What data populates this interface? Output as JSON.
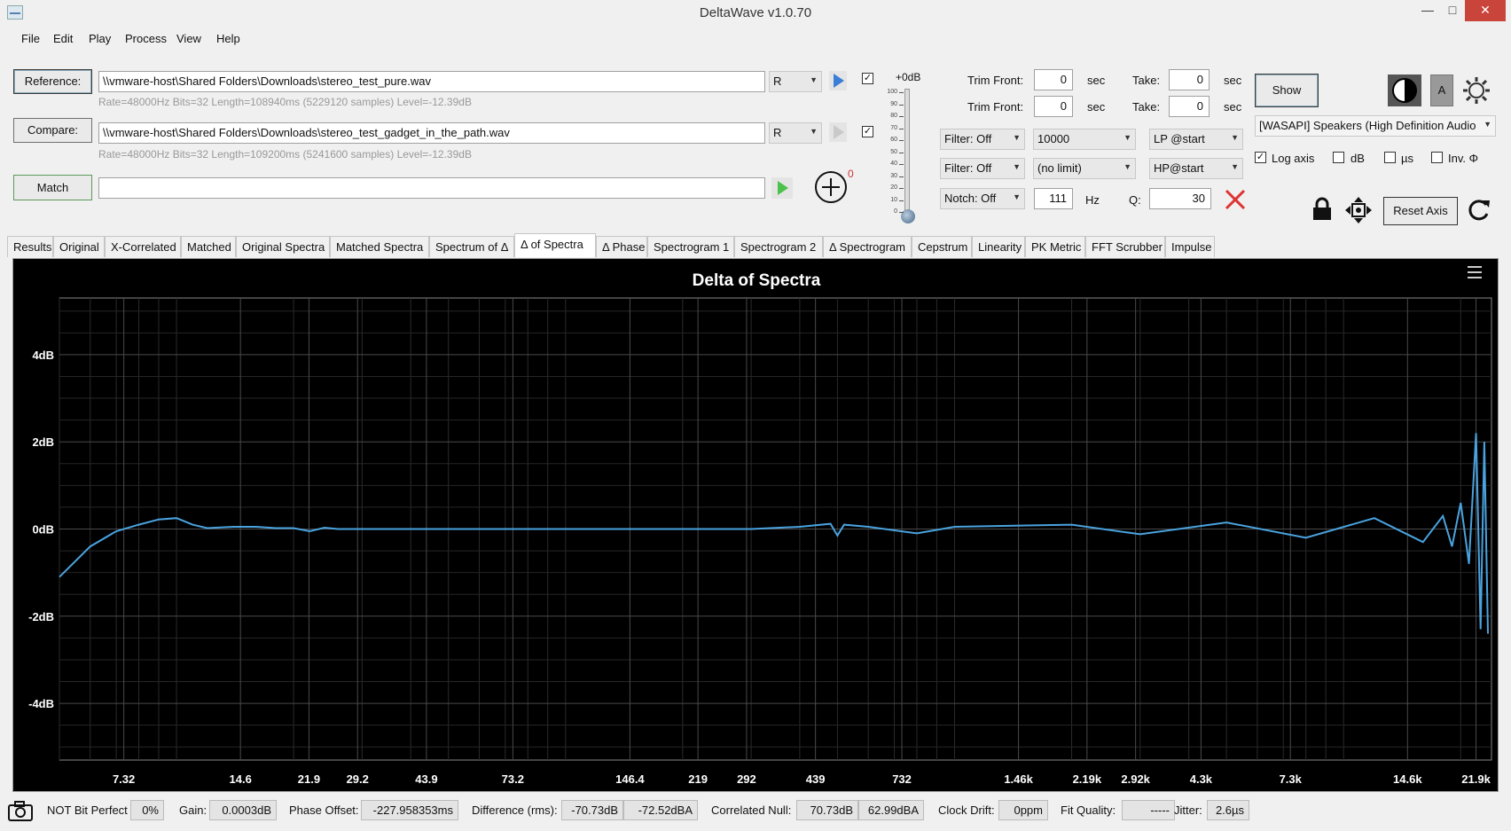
{
  "window": {
    "title": "DeltaWave v1.0.70"
  },
  "menu": [
    "File",
    "Edit",
    "Play",
    "Process",
    "View",
    "Help"
  ],
  "reference": {
    "button": "Reference:",
    "path": "\\\\vmware-host\\Shared Folders\\Downloads\\stereo_test_pure.wav",
    "info": "Rate=48000Hz Bits=32 Length=108940ms (5229120 samples) Level=-12.39dB",
    "channel": "R",
    "checked": true
  },
  "compare": {
    "button": "Compare:",
    "path": "\\\\vmware-host\\Shared Folders\\Downloads\\stereo_test_gadget_in_the_path.wav",
    "info": "Rate=48000Hz Bits=32 Length=109200ms (5241600 samples) Level=-12.39dB",
    "channel": "R",
    "checked": true
  },
  "match": {
    "button": "Match",
    "value": ""
  },
  "add_counter": "0",
  "volume": {
    "label": "+0dB",
    "ticks": [
      "100",
      "90",
      "80",
      "70",
      "60",
      "50",
      "40",
      "30",
      "20",
      "10",
      "0"
    ]
  },
  "trim": {
    "rows": [
      {
        "trim_label": "Trim Front:",
        "trim_value": "0",
        "trim_unit": "sec",
        "take_label": "Take:",
        "take_value": "0",
        "take_unit": "sec"
      },
      {
        "trim_label": "Trim Front:",
        "trim_value": "0",
        "trim_unit": "sec",
        "take_label": "Take:",
        "take_value": "0",
        "take_unit": "sec"
      }
    ]
  },
  "filters": {
    "filter1": {
      "mode": "Filter: Off",
      "freq": "10000",
      "type": "LP @start"
    },
    "filter2": {
      "mode": "Filter: Off",
      "freq": "(no limit)",
      "type": "HP@start"
    },
    "notch": {
      "mode": "Notch: Off",
      "freq": "111",
      "unit": "Hz",
      "q_label": "Q:",
      "q_value": "30"
    }
  },
  "output": {
    "show_button": "Show",
    "device": "[WASAPI] Speakers (High Definition Audio",
    "a_label": "A"
  },
  "axis_options": {
    "log_axis": {
      "label": "Log axis",
      "checked": true
    },
    "db": {
      "label": "dB",
      "checked": false
    },
    "us": {
      "label": "µs",
      "checked": false
    },
    "inv": {
      "label": "Inv. Φ",
      "checked": false
    }
  },
  "reset_axis": "Reset Axis",
  "tabs": [
    {
      "label": "Results"
    },
    {
      "label": "Original"
    },
    {
      "label": "X-Correlated"
    },
    {
      "label": "Matched"
    },
    {
      "label": "Original Spectra"
    },
    {
      "label": "Matched Spectra"
    },
    {
      "label": "Spectrum of Δ"
    },
    {
      "label": "Δ of Spectra",
      "active": true
    },
    {
      "label": "Δ Phase"
    },
    {
      "label": "Spectrogram 1"
    },
    {
      "label": "Spectrogram 2"
    },
    {
      "label": "Δ Spectrogram"
    },
    {
      "label": "Cepstrum"
    },
    {
      "label": "Linearity"
    },
    {
      "label": "PK Metric"
    },
    {
      "label": "FFT Scrubber"
    },
    {
      "label": "Impulse"
    }
  ],
  "chart_data": {
    "type": "line",
    "title": "Delta of Spectra",
    "xlabel": "",
    "ylabel": "",
    "x_scale": "log",
    "x_ticks": [
      "7.32",
      "14.6",
      "21.9",
      "29.2",
      "43.9",
      "73.2",
      "146.4",
      "219",
      "292",
      "439",
      "732",
      "1.46k",
      "2.19k",
      "2.92k",
      "4.3k",
      "7.3k",
      "14.6k",
      "21.9k"
    ],
    "y_ticks": [
      "4dB",
      "2dB",
      "0dB",
      "-2dB",
      "-4dB"
    ],
    "xlim": [
      5,
      24000
    ],
    "ylim": [
      -5.3,
      5.3
    ],
    "grid": true,
    "series": [
      {
        "color": "#4aa3df",
        "x": [
          5,
          6,
          7,
          8,
          9,
          10,
          11,
          12,
          14,
          16,
          18,
          20,
          22,
          24,
          26,
          28,
          30,
          40,
          60,
          100,
          200,
          300,
          400,
          480,
          500,
          520,
          600,
          800,
          1000,
          2000,
          3000,
          5000,
          8000,
          12000,
          16000,
          18000,
          19000,
          20000,
          21000,
          21900,
          22500,
          23000,
          23500
        ],
        "y": [
          -1.1,
          -0.4,
          -0.05,
          0.1,
          0.22,
          0.25,
          0.1,
          0.02,
          0.05,
          0.05,
          0.02,
          0.02,
          -0.05,
          0.03,
          0.0,
          0.0,
          0.0,
          0.0,
          0.0,
          0.0,
          0.0,
          0.0,
          0.05,
          0.12,
          -0.15,
          0.1,
          0.05,
          -0.1,
          0.05,
          0.1,
          -0.12,
          0.15,
          -0.2,
          0.25,
          -0.3,
          0.3,
          -0.4,
          0.6,
          -0.8,
          2.2,
          -2.3,
          2.0,
          -2.4
        ]
      }
    ]
  },
  "status": {
    "bit_perfect": "NOT Bit Perfect",
    "bit_perfect_pct": "0%",
    "gain_label": "Gain:",
    "gain": "0.0003dB",
    "phase_label": "Phase Offset:",
    "phase": "-227.958353ms",
    "diff_label": "Difference (rms):",
    "diff_db": "-70.73dB",
    "diff_dba": "-72.52dBA",
    "null_label": "Correlated Null:",
    "null_db": "70.73dB",
    "null_dba": "62.99dBA",
    "drift_label": "Clock Drift:",
    "drift": "0ppm",
    "fit_label": "Fit Quality:",
    "fit": "-----",
    "jitter_label": "Jitter:",
    "jitter": "2.6µs"
  }
}
